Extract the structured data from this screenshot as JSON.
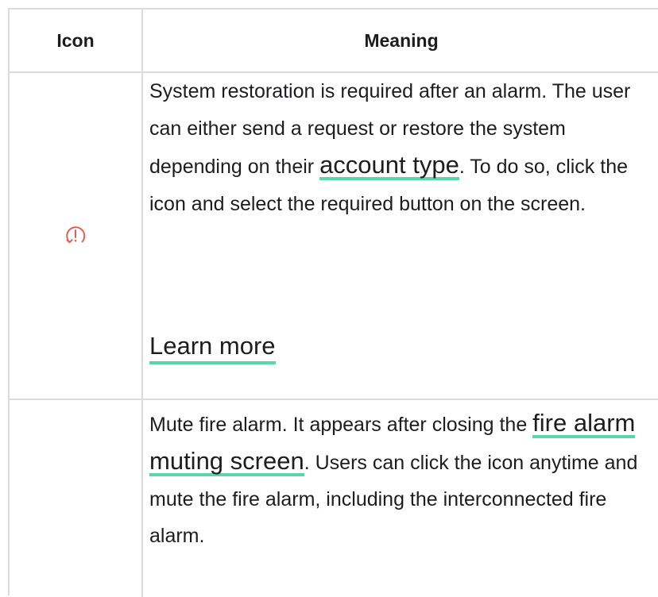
{
  "table": {
    "headers": {
      "icon": "Icon",
      "meaning": "Meaning"
    },
    "rows": [
      {
        "icon": "alarm-restore-icon",
        "icon_color": "#e2614e",
        "text_1": "System restoration is required after an alarm. The user can either send a request or restore the system depending on their ",
        "link_1": "account type",
        "text_2": ". To do so, click the icon and select the required button on the screen.",
        "learn_more": "Learn more"
      },
      {
        "icon": "",
        "text_1": "Mute fire alarm. It appears after closing the ",
        "link_1": "fire alarm muting screen",
        "text_2": ". Users can click the icon anytime and mute the fire alarm, including the interconnected fire alarm."
      }
    ]
  },
  "colors": {
    "border": "#dcdcdc",
    "link_underline": "#5bd6a8",
    "text": "#1d1d1f"
  }
}
